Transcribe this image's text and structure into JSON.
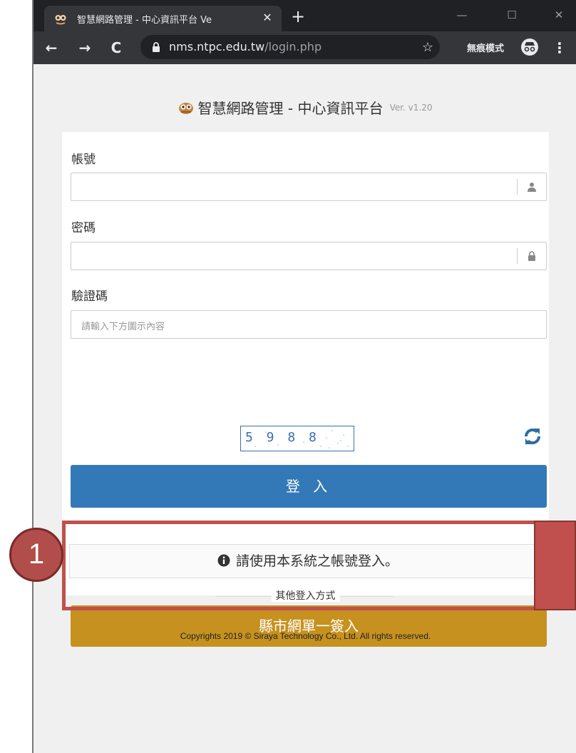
{
  "browser": {
    "tab_title": "智慧網路管理 - 中心資訊平台 Ve",
    "tab_close": "✕",
    "new_tab": "+",
    "window_controls": {
      "minimize": "—",
      "maximize": "☐",
      "close": "✕"
    },
    "nav": {
      "back": "←",
      "forward": "→",
      "reload": "C"
    },
    "url_host": "nms.ntpc.edu.tw",
    "url_path": "/login.php",
    "star": "☆",
    "incognito_label": "無痕模式",
    "menu": "⋮"
  },
  "page": {
    "header_title": "智慧網路管理 - 中心資訊平台",
    "header_version": "Ver. v1.20",
    "form": {
      "account_label": "帳號",
      "account_value": "",
      "password_label": "密碼",
      "password_value": "",
      "captcha_label": "驗證碼",
      "captcha_placeholder": "請輸入下方圖示內容",
      "captcha_image_text": "5 9 8 8",
      "login_button": "登 入"
    },
    "notice": "請使用本系統之帳號登入。",
    "other_login_label": "其他登入方式",
    "sso_button": "縣市網單一簽入",
    "copyright": "Copyrights 2019 © Siraya Technology Co., Ltd. All rights reserved."
  },
  "annotation": {
    "step_number": "1"
  },
  "colors": {
    "login_button": "#3479b7",
    "sso_button": "#c6911f",
    "annotation": "#c0504d"
  }
}
